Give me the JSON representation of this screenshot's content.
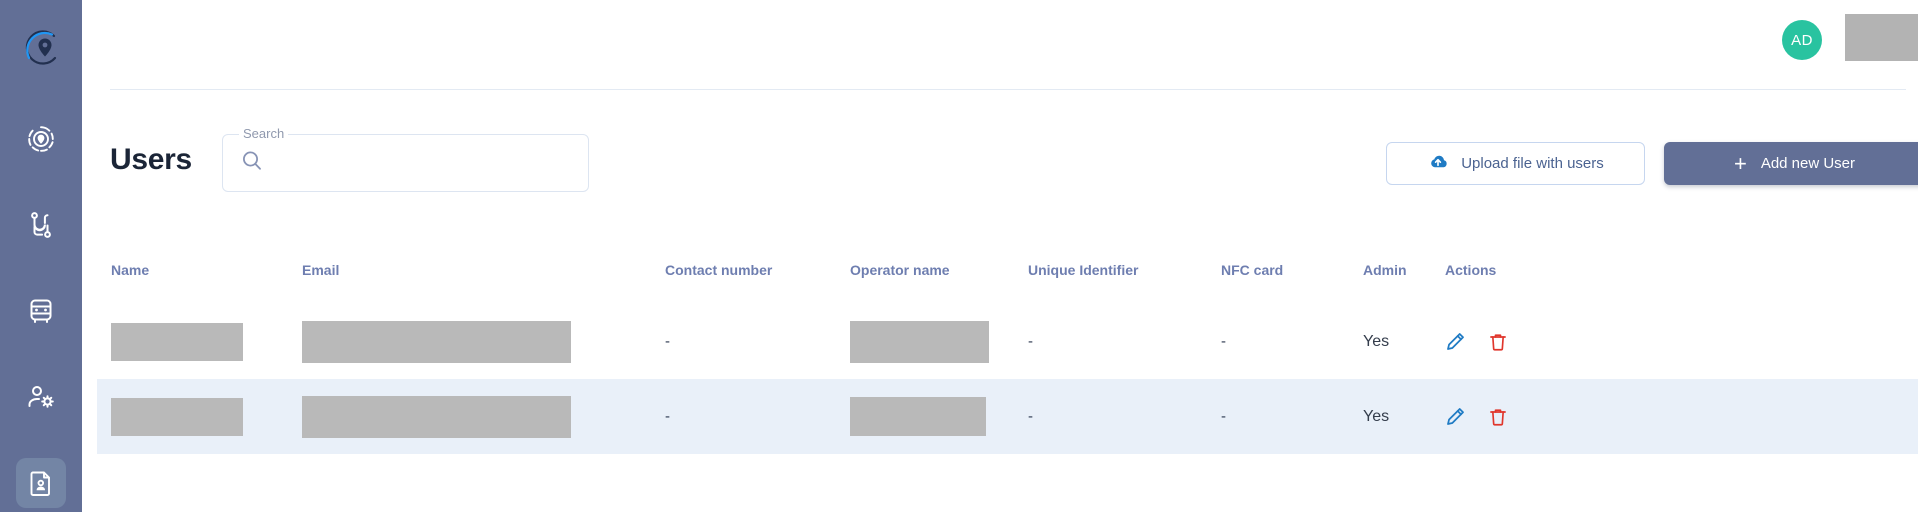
{
  "sidebar": {
    "logo": {
      "name": "app-logo",
      "icon": "location-pin-circle-icon"
    },
    "items": [
      {
        "icon": "target-location-icon",
        "name": "sidebar-item-zones",
        "active": false
      },
      {
        "icon": "route-path-icon",
        "name": "sidebar-item-routes",
        "active": false
      },
      {
        "icon": "bus-icon",
        "name": "sidebar-item-vehicles",
        "active": false
      },
      {
        "icon": "user-settings-icon",
        "name": "sidebar-item-operators",
        "active": false
      },
      {
        "icon": "id-document-icon",
        "name": "sidebar-item-users",
        "active": true
      }
    ]
  },
  "header": {
    "avatar_initials": "AD",
    "avatar_color": "#29c3a0",
    "user_name_redacted": true
  },
  "toolbar": {
    "page_title": "Users",
    "search_label": "Search",
    "search_value": "",
    "search_placeholder": "",
    "search_icon": "search-icon",
    "upload_button_label": "Upload file with users",
    "upload_button_icon": "cloud-upload-icon",
    "add_button_label": "Add new User",
    "add_button_icon": "plus-icon"
  },
  "table": {
    "columns": [
      "Name",
      "Email",
      "Contact number",
      "Operator name",
      "Unique Identifier",
      "NFC card",
      "Admin",
      "Actions"
    ],
    "rows": [
      {
        "name": "",
        "name_redacted": true,
        "email": "",
        "email_redacted": true,
        "contact_number": "-",
        "operator_name": "",
        "operator_redacted": true,
        "unique_identifier": "-",
        "nfc_card": "-",
        "admin": "Yes",
        "actions": [
          "edit-icon",
          "delete-icon"
        ]
      },
      {
        "name": "",
        "name_redacted": true,
        "email": "",
        "email_redacted": true,
        "contact_number": "-",
        "operator_name": "",
        "operator_redacted": true,
        "unique_identifier": "-",
        "nfc_card": "-",
        "admin": "Yes",
        "actions": [
          "edit-icon",
          "delete-icon"
        ]
      }
    ]
  },
  "colors": {
    "sidebar_bg": "#626f96",
    "sidebar_active": "#7385a5",
    "accent_blue": "#1f7bc4",
    "danger_red": "#e0362c",
    "row_alt_bg": "#e9f0f9",
    "header_text": "#6e7eb0",
    "title_text": "#1b2537"
  }
}
